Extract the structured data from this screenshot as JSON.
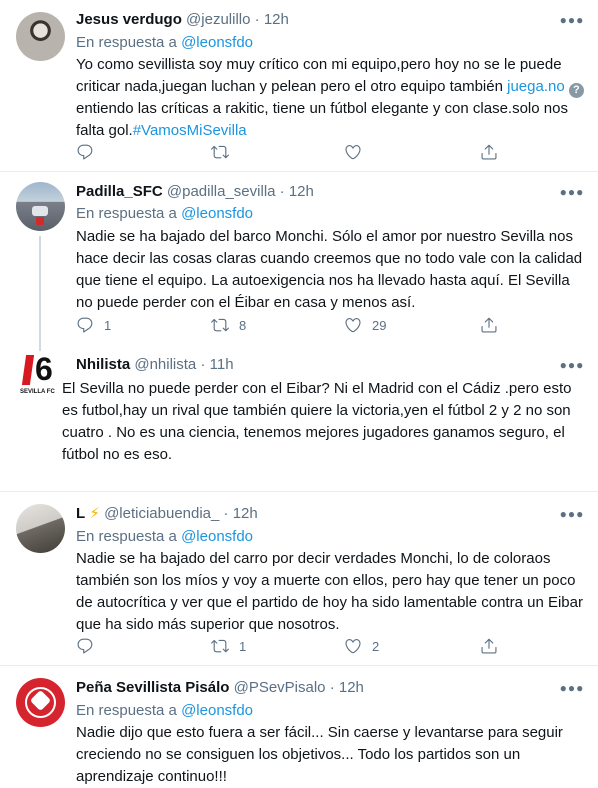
{
  "tweets": [
    {
      "name": "Jesus verdugo",
      "handle": "@jezulillo",
      "dot": "·",
      "time": "12h",
      "reply_prefix": "En respuesta a",
      "reply_to": "@leonsfdo",
      "text_1": "Yo como sevillista soy muy crítico con mi equipo,pero hoy no se le puede criticar nada,juegan luchan y pelean pero el otro equipo también",
      "link": "juega.no",
      "qmark": "?",
      "text_2": "entiendo las críticas a rakitic, tiene un fútbol elegante y con clase.solo nos falta gol.",
      "hashtag": "#VamosMiSevilla",
      "replies": "",
      "retweets": "",
      "likes": ""
    },
    {
      "name": "Padilla_SFC",
      "handle": "@padilla_sevilla",
      "dot": "·",
      "time": "12h",
      "reply_prefix": "En respuesta a",
      "reply_to": "@leonsfdo",
      "text": "Nadie se ha bajado del barco Monchi. Sólo el amor por nuestro Sevilla nos hace decir las cosas claras cuando creemos que no todo vale con la calidad que tiene el equipo. La autoexigencia nos ha llevado hasta aquí. El Sevilla no puede perder con el Éibar en casa y menos así.",
      "replies": "1",
      "retweets": "8",
      "likes": "29"
    },
    {
      "name": "Nhilista",
      "handle": "@nhilista",
      "dot": "·",
      "time": "11h",
      "avatar_text": "6",
      "avatar_sub": "SEVILLA FC",
      "text": "El Sevilla no puede perder con el Eibar? Ni el Madrid con el Cádiz .pero esto es futbol,hay un rival que también quiere la victoria,yen  el fútbol 2 y 2 no son cuatro . No es una ciencia, tenemos mejores jugadores ganamos seguro, el fútbol no es eso.",
      "replies": "",
      "retweets": "",
      "likes": ""
    },
    {
      "name": "L",
      "handle": "@leticiabuendia_",
      "dot": "·",
      "time": "12h",
      "reply_prefix": "En respuesta a",
      "reply_to": "@leonsfdo",
      "text": "Nadie se ha bajado del carro por decir verdades Monchi, lo de coloraos también son los míos y voy a muerte con ellos, pero hay que tener un poco de autocrítica y ver que el partido de hoy ha sido lamentable contra un Eibar que ha sido más superior que nosotros.",
      "replies": "",
      "retweets": "1",
      "likes": "2"
    },
    {
      "name": "Peña Sevillista Pisálo",
      "handle": "@PSevPisalo",
      "dot": "·",
      "time": "12h",
      "reply_prefix": "En respuesta a",
      "reply_to": "@leonsfdo",
      "text": "Nadie dijo que esto fuera a ser fácil... Sin caerse y levantarse para seguir creciendo no se consiguen los objetivos... Todo los partidos son un aprendizaje continuo!!!"
    }
  ]
}
